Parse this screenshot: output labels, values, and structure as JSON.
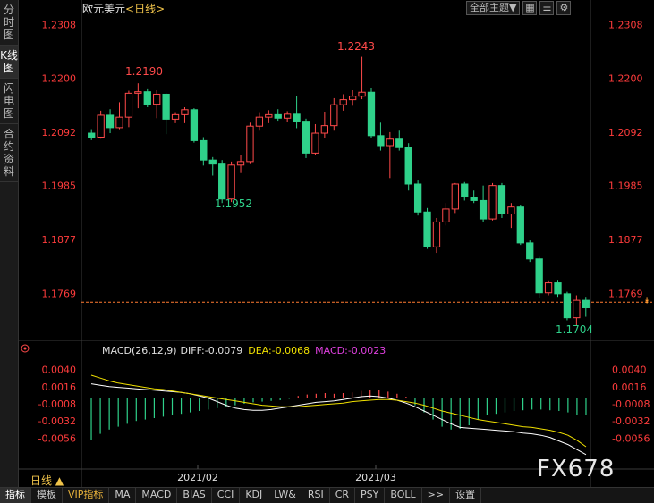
{
  "sidebar": {
    "tabs": [
      "分时图",
      "K线图",
      "闪电图",
      "合约资料"
    ],
    "active": 1
  },
  "header": {
    "symbol": "欧元美元",
    "period_tag": "<日线>",
    "theme_select": "全部主题",
    "theme_arrow": "▼"
  },
  "price_labels": {
    "high": "1.2243",
    "high2": "1.2190",
    "low1": "1.1952",
    "low2": "1.1704"
  },
  "macd": {
    "title": "MACD(26,12,9)",
    "diff": "DIFF:-0.0079",
    "dea": "DEA:-0.0068",
    "macd": "MACD:-0.0023"
  },
  "x_axis": {
    "ticks": [
      "2021/02",
      "2021/03"
    ]
  },
  "period_button": "日线 ▲",
  "toolbar": [
    "指标",
    "模板",
    "VIP指标",
    "MA",
    "MACD",
    "BIAS",
    "CCI",
    "KDJ",
    "LW&",
    "RSI",
    "CR",
    "PSY",
    "BOLL",
    ">>",
    "设置"
  ],
  "watermark": "FX678",
  "colors": {
    "up": "#ff4a4a",
    "down": "#2fd18a",
    "grid": "#3a3a3a",
    "price_text": "#ff3c3c",
    "dea": "#f0e000",
    "macd_label": "#e040e0"
  },
  "chart_data": {
    "type": "candlestick",
    "ylim": [
      1.168,
      1.233
    ],
    "y_ticks": [
      "1.2308",
      "1.2200",
      "1.2092",
      "1.1985",
      "1.1877",
      "1.1769"
    ],
    "current_price": 1.1769,
    "candles": [
      {
        "o": 1.209,
        "h": 1.2098,
        "l": 1.2076,
        "c": 1.2082
      },
      {
        "o": 1.2082,
        "h": 1.2135,
        "l": 1.2079,
        "c": 1.2126
      },
      {
        "o": 1.2126,
        "h": 1.2138,
        "l": 1.209,
        "c": 1.2101
      },
      {
        "o": 1.2101,
        "h": 1.2152,
        "l": 1.2098,
        "c": 1.2122
      },
      {
        "o": 1.2122,
        "h": 1.2175,
        "l": 1.2102,
        "c": 1.217
      },
      {
        "o": 1.217,
        "h": 1.219,
        "l": 1.214,
        "c": 1.2173
      },
      {
        "o": 1.2173,
        "h": 1.2178,
        "l": 1.2142,
        "c": 1.2148
      },
      {
        "o": 1.2148,
        "h": 1.2176,
        "l": 1.212,
        "c": 1.2168
      },
      {
        "o": 1.2168,
        "h": 1.217,
        "l": 1.2088,
        "c": 1.2118
      },
      {
        "o": 1.2118,
        "h": 1.2132,
        "l": 1.211,
        "c": 1.2127
      },
      {
        "o": 1.2127,
        "h": 1.2142,
        "l": 1.211,
        "c": 1.2137
      },
      {
        "o": 1.2137,
        "h": 1.214,
        "l": 1.2071,
        "c": 1.2075
      },
      {
        "o": 1.2075,
        "h": 1.2082,
        "l": 1.2025,
        "c": 1.2036
      },
      {
        "o": 1.2036,
        "h": 1.2042,
        "l": 1.2005,
        "c": 1.2028
      },
      {
        "o": 1.2028,
        "h": 1.2036,
        "l": 1.195,
        "c": 1.1958
      },
      {
        "o": 1.1958,
        "h": 1.2033,
        "l": 1.1952,
        "c": 1.2026
      },
      {
        "o": 1.2026,
        "h": 1.2046,
        "l": 1.201,
        "c": 1.2033
      },
      {
        "o": 1.2033,
        "h": 1.2111,
        "l": 1.2028,
        "c": 1.2104
      },
      {
        "o": 1.2104,
        "h": 1.2132,
        "l": 1.2095,
        "c": 1.2122
      },
      {
        "o": 1.2122,
        "h": 1.2136,
        "l": 1.211,
        "c": 1.2127
      },
      {
        "o": 1.2127,
        "h": 1.2138,
        "l": 1.2115,
        "c": 1.212
      },
      {
        "o": 1.212,
        "h": 1.2134,
        "l": 1.2113,
        "c": 1.2128
      },
      {
        "o": 1.2128,
        "h": 1.2165,
        "l": 1.21,
        "c": 1.2114
      },
      {
        "o": 1.2114,
        "h": 1.2119,
        "l": 1.204,
        "c": 1.205
      },
      {
        "o": 1.205,
        "h": 1.2108,
        "l": 1.2046,
        "c": 1.209
      },
      {
        "o": 1.209,
        "h": 1.2133,
        "l": 1.208,
        "c": 1.2105
      },
      {
        "o": 1.2105,
        "h": 1.216,
        "l": 1.2095,
        "c": 1.2147
      },
      {
        "o": 1.2147,
        "h": 1.2168,
        "l": 1.2135,
        "c": 1.2157
      },
      {
        "o": 1.2157,
        "h": 1.2176,
        "l": 1.2145,
        "c": 1.2164
      },
      {
        "o": 1.2164,
        "h": 1.2243,
        "l": 1.2158,
        "c": 1.2172
      },
      {
        "o": 1.2172,
        "h": 1.2181,
        "l": 1.208,
        "c": 1.2085
      },
      {
        "o": 1.2085,
        "h": 1.2111,
        "l": 1.2055,
        "c": 1.2065
      },
      {
        "o": 1.2065,
        "h": 1.2092,
        "l": 1.2,
        "c": 1.2078
      },
      {
        "o": 1.2078,
        "h": 1.2095,
        "l": 1.2055,
        "c": 1.2061
      },
      {
        "o": 1.2061,
        "h": 1.207,
        "l": 1.1975,
        "c": 1.1988
      },
      {
        "o": 1.1988,
        "h": 1.1995,
        "l": 1.1925,
        "c": 1.1932
      },
      {
        "o": 1.1932,
        "h": 1.194,
        "l": 1.1858,
        "c": 1.1862
      },
      {
        "o": 1.1862,
        "h": 1.192,
        "l": 1.185,
        "c": 1.1912
      },
      {
        "o": 1.1912,
        "h": 1.195,
        "l": 1.1905,
        "c": 1.1938
      },
      {
        "o": 1.1938,
        "h": 1.199,
        "l": 1.193,
        "c": 1.1988
      },
      {
        "o": 1.1988,
        "h": 1.1992,
        "l": 1.1955,
        "c": 1.1962
      },
      {
        "o": 1.1962,
        "h": 1.1975,
        "l": 1.195,
        "c": 1.1955
      },
      {
        "o": 1.1955,
        "h": 1.1985,
        "l": 1.1912,
        "c": 1.1918
      },
      {
        "o": 1.1918,
        "h": 1.199,
        "l": 1.1915,
        "c": 1.1985
      },
      {
        "o": 1.1985,
        "h": 1.199,
        "l": 1.192,
        "c": 1.1928
      },
      {
        "o": 1.1928,
        "h": 1.195,
        "l": 1.19,
        "c": 1.1942
      },
      {
        "o": 1.1942,
        "h": 1.1946,
        "l": 1.1866,
        "c": 1.187
      },
      {
        "o": 1.187,
        "h": 1.1875,
        "l": 1.1832,
        "c": 1.1838
      },
      {
        "o": 1.1838,
        "h": 1.1842,
        "l": 1.176,
        "c": 1.177
      },
      {
        "o": 1.177,
        "h": 1.1795,
        "l": 1.1765,
        "c": 1.179
      },
      {
        "o": 1.179,
        "h": 1.1796,
        "l": 1.1762,
        "c": 1.1768
      },
      {
        "o": 1.1768,
        "h": 1.1772,
        "l": 1.1715,
        "c": 1.172
      },
      {
        "o": 1.172,
        "h": 1.1765,
        "l": 1.1704,
        "c": 1.1755
      },
      {
        "o": 1.1755,
        "h": 1.1762,
        "l": 1.1722,
        "c": 1.174
      }
    ],
    "macd_panel": {
      "ylim": [
        -0.0068,
        0.0052
      ],
      "y_ticks": [
        "0.0040",
        "0.0016",
        "-0.0008",
        "-0.0032",
        "-0.0056"
      ],
      "diff": [
        0.002,
        0.0018,
        0.0016,
        0.0015,
        0.0014,
        0.0013,
        0.0012,
        0.0011,
        0.001,
        0.0009,
        0.0008,
        0.0006,
        0.0003,
        0.0,
        -0.0005,
        -0.001,
        -0.0014,
        -0.0016,
        -0.0017,
        -0.0017,
        -0.0016,
        -0.0014,
        -0.0012,
        -0.001,
        -0.0008,
        -0.0006,
        -0.0005,
        -0.0004,
        -0.0002,
        0.0,
        0.0002,
        0.0003,
        0.0002,
        0.0,
        -0.0003,
        -0.0007,
        -0.0012,
        -0.0018,
        -0.0024,
        -0.003,
        -0.0036,
        -0.0041,
        -0.0042,
        -0.0043,
        -0.0044,
        -0.0045,
        -0.0046,
        -0.0047,
        -0.0049,
        -0.005,
        -0.0052,
        -0.0055,
        -0.006,
        -0.0065,
        -0.0072,
        -0.0079
      ],
      "dea": [
        0.0032,
        0.0028,
        0.0024,
        0.0021,
        0.0019,
        0.0017,
        0.0015,
        0.0013,
        0.0012,
        0.001,
        0.0008,
        0.0006,
        0.0004,
        0.0002,
        0.0,
        -0.0002,
        -0.0004,
        -0.0006,
        -0.0008,
        -0.001,
        -0.0011,
        -0.0012,
        -0.0012,
        -0.0012,
        -0.0011,
        -0.001,
        -0.0009,
        -0.0008,
        -0.0007,
        -0.0005,
        -0.0004,
        -0.0003,
        -0.0002,
        -0.0002,
        -0.0003,
        -0.0005,
        -0.0007,
        -0.001,
        -0.0014,
        -0.0018,
        -0.0021,
        -0.0024,
        -0.0027,
        -0.003,
        -0.0032,
        -0.0034,
        -0.0036,
        -0.0038,
        -0.004,
        -0.0041,
        -0.0043,
        -0.0045,
        -0.0048,
        -0.0052,
        -0.0059,
        -0.0068
      ],
      "histogram": [
        -0.0058,
        -0.005,
        -0.0044,
        -0.004,
        -0.0036,
        -0.0032,
        -0.003,
        -0.0028,
        -0.0026,
        -0.0024,
        -0.0022,
        -0.002,
        -0.0018,
        -0.0016,
        -0.0014,
        -0.0012,
        -0.001,
        -0.0008,
        -0.0006,
        -0.0005,
        -0.0004,
        -0.0003,
        -0.0001,
        0.0003,
        0.0005,
        0.0006,
        0.0007,
        0.0006,
        0.0007,
        0.0008,
        0.001,
        0.0012,
        0.0011,
        0.0009,
        0.0006,
        0.0002,
        -0.001,
        -0.002,
        -0.003,
        -0.004,
        -0.0044,
        -0.0043,
        -0.0038,
        -0.003,
        -0.0024,
        -0.0022,
        -0.002,
        -0.0018,
        -0.0017,
        -0.0016,
        -0.0016,
        -0.0017,
        -0.0018,
        -0.002,
        -0.0023,
        -0.0023
      ]
    }
  }
}
